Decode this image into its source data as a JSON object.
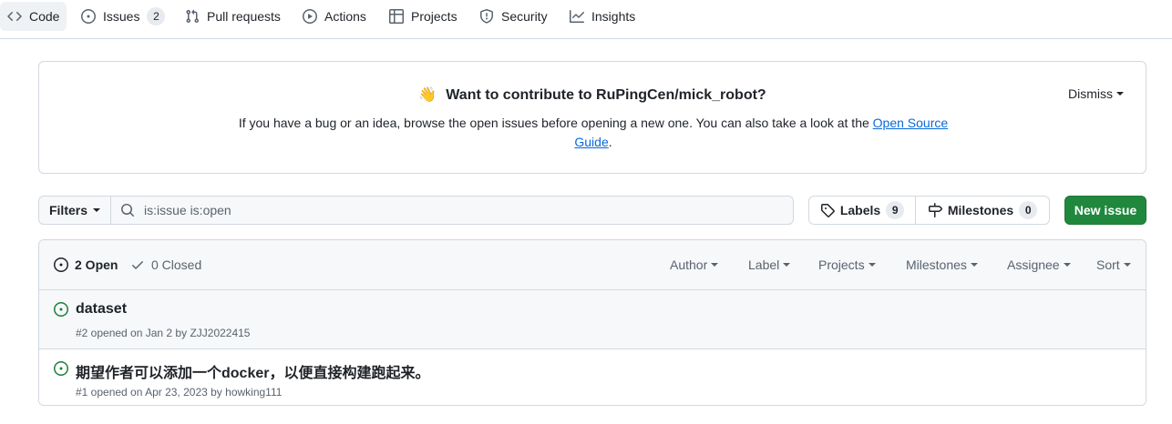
{
  "nav": {
    "tabs": [
      {
        "label": "Code",
        "icon": "code-icon"
      },
      {
        "label": "Issues",
        "icon": "issue-opened-icon",
        "count": "2"
      },
      {
        "label": "Pull requests",
        "icon": "git-pull-request-icon"
      },
      {
        "label": "Actions",
        "icon": "play-icon"
      },
      {
        "label": "Projects",
        "icon": "table-icon"
      },
      {
        "label": "Security",
        "icon": "shield-icon"
      },
      {
        "label": "Insights",
        "icon": "graph-icon"
      }
    ]
  },
  "banner": {
    "emoji": "👋",
    "title": "Want to contribute to RuPingCen/mick_robot?",
    "text_before": "If you have a bug or an idea, browse the open issues before opening a new one. You can also take a look at the ",
    "link": "Open Source Guide",
    "text_after": ".",
    "dismiss": "Dismiss"
  },
  "filters": {
    "filters_label": "Filters",
    "search_value": "is:issue is:open",
    "labels_label": "Labels",
    "labels_count": "9",
    "milestones_label": "Milestones",
    "milestones_count": "0",
    "new_issue_label": "New issue"
  },
  "list": {
    "open_label": "2 Open",
    "closed_label": "0 Closed",
    "header_filters": [
      "Author",
      "Label",
      "Projects",
      "Milestones",
      "Assignee",
      "Sort"
    ],
    "issues": [
      {
        "title": "dataset",
        "meta": "#2 opened on Jan 2 by ZJJ2022415"
      },
      {
        "title": "期望作者可以添加一个docker，以便直接构建跑起来。",
        "meta": "#1 opened on Apr 23, 2023 by howking111"
      }
    ]
  },
  "colors": {
    "accent_green": "#1f883d",
    "open_icon_green": "#1a7f37",
    "link_blue": "#0969da"
  }
}
